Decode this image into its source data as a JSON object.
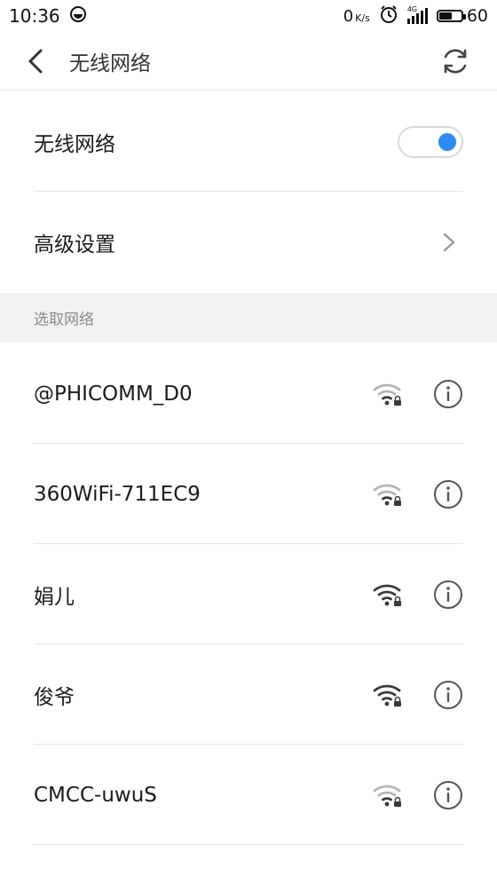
{
  "status_bar": {
    "time": "10:36",
    "net_speed": "0",
    "net_speed_unit": "K/s",
    "network_type": "4G",
    "battery_level": "60",
    "battery_fraction": 0.6
  },
  "header": {
    "title": "无线网络",
    "back_icon": "back-chevron-icon",
    "refresh_icon": "refresh-icon"
  },
  "wifi_toggle": {
    "label": "无线网络",
    "on": true,
    "accent": "#2b8bf0"
  },
  "advanced": {
    "label": "高级设置"
  },
  "section": {
    "label": "选取网络"
  },
  "networks": [
    {
      "ssid": "@PHICOMM_D0",
      "signal": "weak",
      "secured": true
    },
    {
      "ssid": "360WiFi-711EC9",
      "signal": "weak",
      "secured": true
    },
    {
      "ssid": "娟儿",
      "signal": "strong",
      "secured": true
    },
    {
      "ssid": "俊爷",
      "signal": "strong",
      "secured": true
    },
    {
      "ssid": "CMCC-uwuS",
      "signal": "weak",
      "secured": true
    }
  ]
}
